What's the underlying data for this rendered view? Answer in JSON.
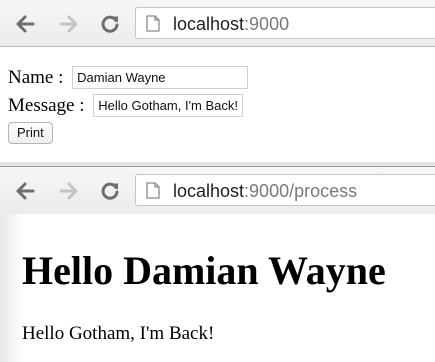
{
  "form_window": {
    "address_bar": {
      "host": "localhost",
      "rest": ":9000"
    },
    "form": {
      "name_label": "Name :",
      "name_value": "Damian Wayne",
      "message_label": "Message :",
      "message_value": "Hello Gotham, I'm Back!",
      "print_label": "Print"
    }
  },
  "result_window": {
    "address_bar": {
      "host": "localhost",
      "rest": ":9000/process"
    },
    "heading": "Hello Damian Wayne",
    "message": "Hello Gotham, I'm Back!"
  },
  "icons": {
    "back": "back-arrow-icon",
    "forward": "forward-arrow-icon",
    "reload": "reload-icon",
    "page": "page-icon"
  },
  "colors": {
    "toolbar": "#f0f0f0",
    "nav_icon": "#6e6e6e",
    "nav_icon_disabled": "#c4c4c4",
    "url_host": "#1f1f1f",
    "url_path": "#7a7a7a"
  }
}
